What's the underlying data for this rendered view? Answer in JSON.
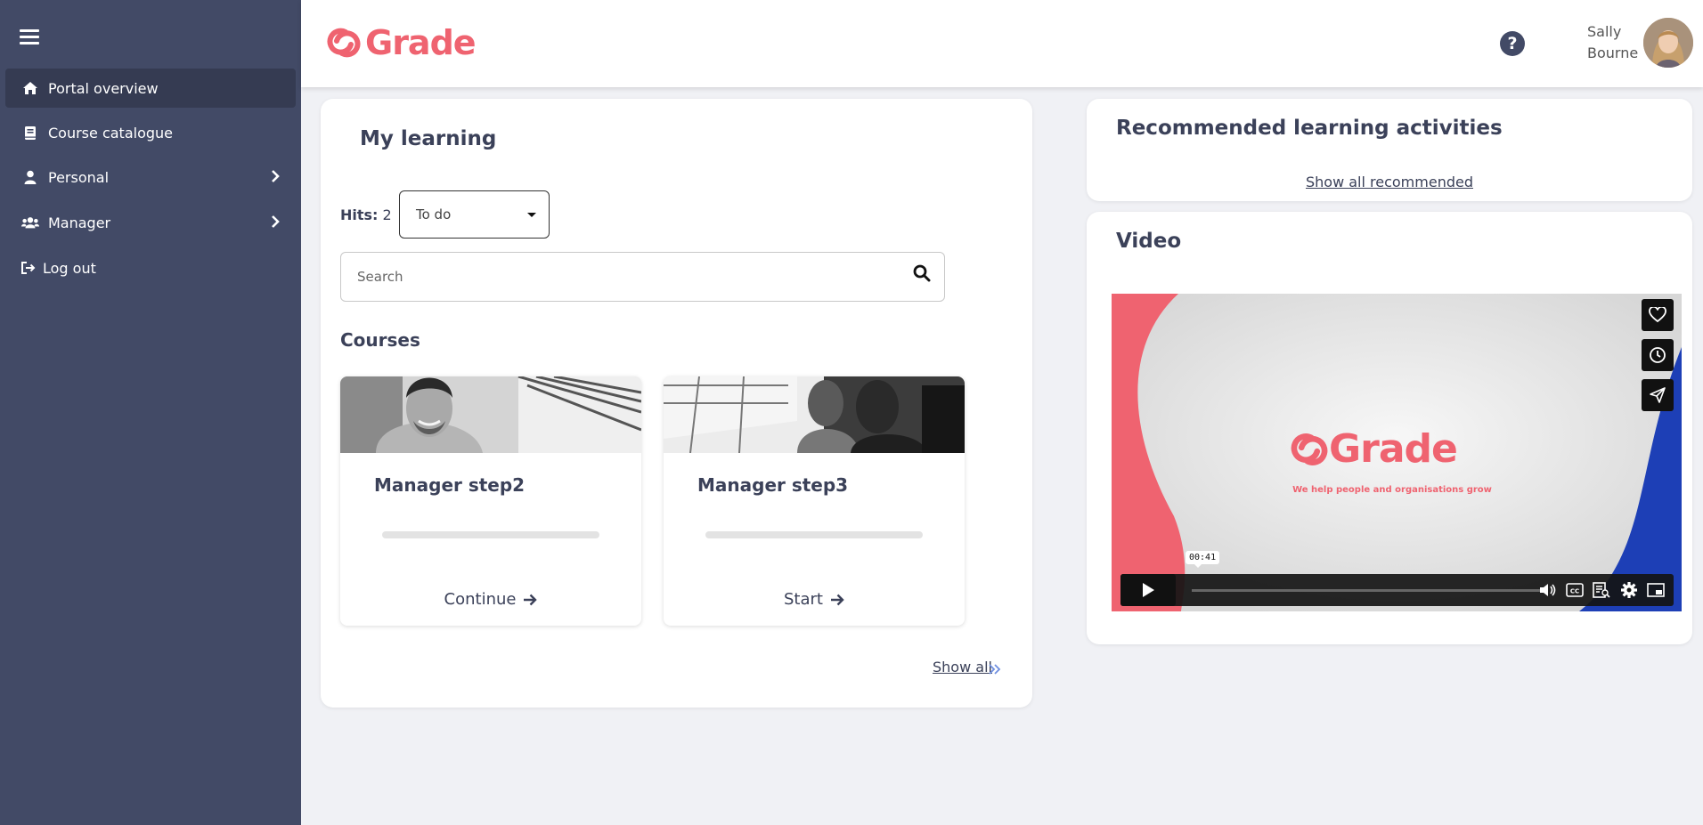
{
  "sidebar": {
    "items": [
      {
        "label": "Portal overview",
        "icon": "home-icon"
      },
      {
        "label": "Course catalogue",
        "icon": "book-icon"
      },
      {
        "label": "Personal",
        "icon": "user-icon"
      },
      {
        "label": "Manager",
        "icon": "users-icon"
      },
      {
        "label": "Log out",
        "icon": "sign-out-icon"
      }
    ]
  },
  "header": {
    "logo_text": "Grade",
    "user_first": "Sally",
    "user_last": "Bourne",
    "help_glyph": "?"
  },
  "my_learning": {
    "title": "My learning",
    "hits_label": "Hits:",
    "hits_value": "2",
    "filter_value": "To do",
    "search_placeholder": "Search",
    "section_title": "Courses",
    "courses": [
      {
        "title": "Manager step2",
        "action": "Continue",
        "progress": 0
      },
      {
        "title": "Manager step3",
        "action": "Start",
        "progress": 0
      }
    ],
    "show_all": "Show all"
  },
  "recommended": {
    "title": "Recommended learning activities",
    "show_all": "Show all recommended"
  },
  "video": {
    "title": "Video",
    "logo_text": "Grade",
    "tagline": "We help people and organisations grow",
    "time": "00:41"
  },
  "colors": {
    "accent": "#ef6370",
    "sidebar": "#424a66",
    "sidebar_active": "#353b52",
    "text": "#3b4159",
    "background": "#f0f1f5"
  }
}
